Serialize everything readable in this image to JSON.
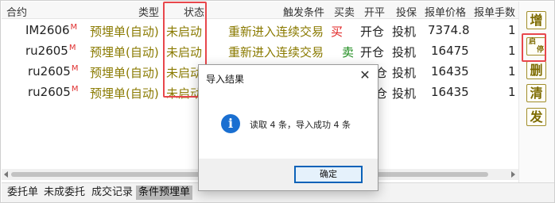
{
  "header": {
    "col_contract": "合约",
    "col_type": "类型",
    "col_status": "状态",
    "col_trigger": "触发条件",
    "col_side": "买卖",
    "col_openclose": "开平",
    "col_hedge": "投保",
    "col_price": "报单价格",
    "col_qty": "报单手数"
  },
  "rows": [
    {
      "contract": "IM2606",
      "mark": "M",
      "type": "预埋单(自动)",
      "status": "未启动",
      "trigger": "重新进入连续交易",
      "side": "买",
      "side_color": "#e02020",
      "openclose": "开仓",
      "hedge": "投机",
      "price": "7374.8",
      "qty": "1"
    },
    {
      "contract": "ru2605",
      "mark": "M",
      "type": "预埋单(自动)",
      "status": "未启动",
      "trigger": "重新进入连续交易",
      "side": "卖",
      "side_color": "#1a8a1a",
      "openclose": "开仓",
      "hedge": "投机",
      "price": "16475",
      "qty": "1"
    },
    {
      "contract": "ru2605",
      "mark": "M",
      "type": "预埋单(自动)",
      "status": "未启动",
      "trigger": "",
      "side": "",
      "openclose": "仓",
      "hedge": "投机",
      "price": "16435",
      "qty": "1"
    },
    {
      "contract": "ru2605",
      "mark": "M",
      "type": "预埋单(自动)",
      "status": "未启动",
      "trigger": "",
      "side": "",
      "openclose": "仓",
      "hedge": "投机",
      "price": "16435",
      "qty": "1"
    }
  ],
  "toolbar": {
    "add_label": "增",
    "startstop_label_top": "启",
    "startstop_label_bottom": "停",
    "delete_label": "删",
    "clear_label": "清",
    "send_label": "发"
  },
  "tabs": [
    "委托单",
    "未成委托",
    "成交记录",
    "条件预埋单"
  ],
  "active_tab": "条件预埋单",
  "dialog": {
    "title": "导入结果",
    "message": "读取 4 条，导入成功 4 条",
    "ok_label": "确定",
    "icon": "info-icon"
  },
  "colors": {
    "highlight": "#e8474c",
    "olive_text": "#8a7a00",
    "accent_blue": "#0b62b8"
  }
}
